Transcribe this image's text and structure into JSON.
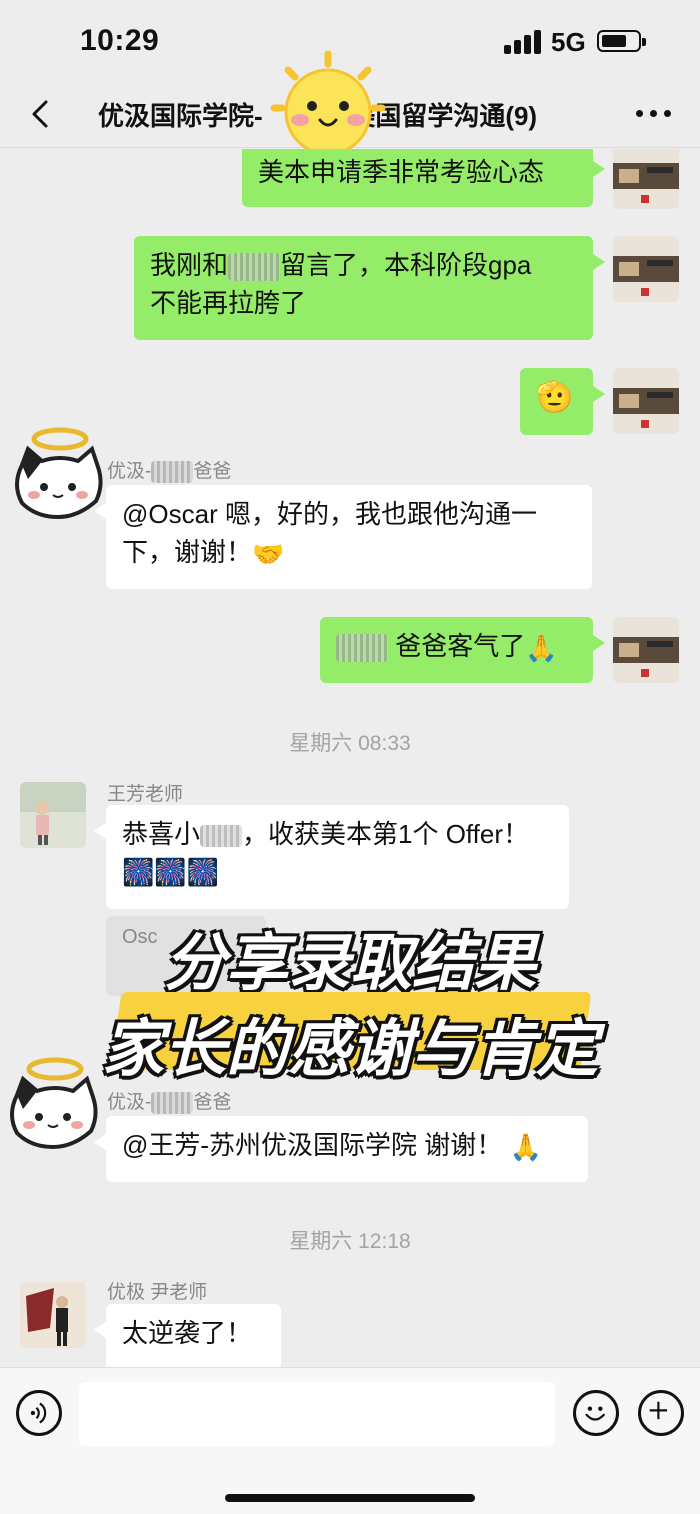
{
  "status_bar": {
    "time": "10:29",
    "network": "5G"
  },
  "nav": {
    "title": "优汲国际学院-　　　-美国留学沟通(9)"
  },
  "messages": {
    "m1": {
      "text": "美本申请季非常考验心态"
    },
    "m2": {
      "line1_a": "我刚和",
      "line1_b": "留言了，本科阶段gpa",
      "line2": "不能再拉胯了"
    },
    "m3": {
      "emoji": "🫡"
    },
    "m4": {
      "sender_a": "优汲-",
      "sender_b": "爸爸",
      "line1": "@Oscar 嗯，好的，我也跟他沟通一",
      "line2": "下，谢谢！",
      "emoji": "🤝"
    },
    "m5": {
      "text": "爸爸客气了",
      "emoji": "🙏"
    },
    "ts1": "星期六 08:33",
    "m6": {
      "sender": "王芳老师",
      "line1_a": "恭喜小",
      "line1_b": "，收获美本第1个 Offer！",
      "line2": "🎆🎆🎆"
    },
    "m7": {
      "quote": "Osc"
    },
    "m8": {
      "sender_a": "优汲-",
      "sender_b": "爸爸",
      "text": "@王芳-苏州优汲国际学院 谢谢！",
      "emoji": "🙏"
    },
    "ts2": "星期六 12:18",
    "m9": {
      "sender": "优极 尹老师",
      "text": "太逆袭了！"
    }
  },
  "overlay": {
    "caption1": "分享录取结果",
    "caption2": "家长的感谢与肯定"
  },
  "colors": {
    "outgoing_bubble": "#95ec69",
    "incoming_bubble": "#ffffff",
    "background": "#ededed",
    "highlight": "#f7d23e"
  },
  "icons": [
    "back-icon",
    "more-icon",
    "voice-icon",
    "emoji-icon",
    "plus-icon",
    "sun-sticker",
    "cat-avatar-icon"
  ]
}
